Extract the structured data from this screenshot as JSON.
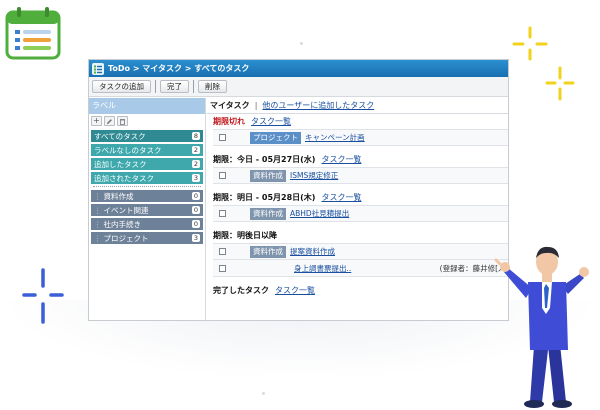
{
  "window": {
    "breadcrumb": "ToDo > マイタスク > すべてのタスク"
  },
  "toolbar": {
    "add_task_label": "タスクの追加",
    "complete_label": "完了",
    "delete_label": "削除"
  },
  "sidebar": {
    "header": "ラベル",
    "tools": [
      "add-icon",
      "edit-icon",
      "trash-icon"
    ],
    "primary_items": [
      {
        "label": "すべてのタスク",
        "count": "8"
      },
      {
        "label": "ラベルなしのタスク",
        "count": "2"
      },
      {
        "label": "追加したタスク",
        "count": "2"
      },
      {
        "label": "追加されたタスク",
        "count": "3"
      }
    ],
    "custom_items": [
      {
        "label": "資料作成",
        "count": "0"
      },
      {
        "label": "イベント関連",
        "count": "0"
      },
      {
        "label": "社内手続き",
        "count": "0"
      },
      {
        "label": "プロジェクト",
        "count": "3"
      }
    ]
  },
  "main": {
    "tab_mytask": "マイタスク",
    "tab_separator": "|",
    "tab_others": "他のユーザーに追加したタスク",
    "sections": {
      "overdue": {
        "title": "期限切れ",
        "link": "タスク一覧",
        "tasks": [
          {
            "tag": "プロジェクト",
            "title": "キャンペーン計画"
          }
        ]
      },
      "today": {
        "title": "期限：今日 - 05月27日(水)",
        "link": "タスク一覧",
        "tasks": [
          {
            "tag": "資料作成",
            "title": "ISMS規定修正"
          }
        ]
      },
      "tomorrow": {
        "title": "期限：明日 - 05月28日(木)",
        "link": "タスク一覧",
        "tasks": [
          {
            "tag": "資料作成",
            "title": "ABHD社見積提出"
          }
        ]
      },
      "later": {
        "title": "期限：明後日以降",
        "tasks": [
          {
            "tag": "資料作成",
            "title": "提案資料作成"
          },
          {
            "title": "身上調書票提出..",
            "meta": "(登録者：藤井修[人事総務"
          }
        ]
      },
      "completed": {
        "title": "完了したタスク",
        "link": "タスク一覧"
      }
    }
  },
  "colors": {
    "titlebar": "#1a6fb0",
    "sidebar_header": "#a9c9e8",
    "label_teal": "#3ea8ad",
    "label_slate": "#6d8198",
    "overdue_red": "#c0181e",
    "link_blue": "#1a4fa0",
    "sparkle_yellow": "#f2d21a",
    "sparkle_blue": "#3b5fd6"
  }
}
